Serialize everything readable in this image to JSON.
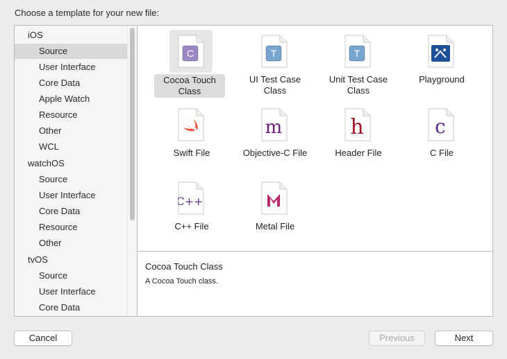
{
  "dialog": {
    "heading": "Choose a template for your new file:"
  },
  "sidebar": {
    "rows": [
      {
        "label": "iOS",
        "kind": "group"
      },
      {
        "label": "Source",
        "kind": "item",
        "selected": true
      },
      {
        "label": "User Interface",
        "kind": "item"
      },
      {
        "label": "Core Data",
        "kind": "item"
      },
      {
        "label": "Apple Watch",
        "kind": "item"
      },
      {
        "label": "Resource",
        "kind": "item"
      },
      {
        "label": "Other",
        "kind": "item"
      },
      {
        "label": "WCL",
        "kind": "item"
      },
      {
        "label": "watchOS",
        "kind": "group"
      },
      {
        "label": "Source",
        "kind": "item"
      },
      {
        "label": "User Interface",
        "kind": "item"
      },
      {
        "label": "Core Data",
        "kind": "item"
      },
      {
        "label": "Resource",
        "kind": "item"
      },
      {
        "label": "Other",
        "kind": "item"
      },
      {
        "label": "tvOS",
        "kind": "group"
      },
      {
        "label": "Source",
        "kind": "item"
      },
      {
        "label": "User Interface",
        "kind": "item"
      },
      {
        "label": "Core Data",
        "kind": "item"
      }
    ]
  },
  "templates": [
    {
      "label": "Cocoa Touch Class",
      "icon": "cocoa-touch-class-icon",
      "glyph": "C",
      "selected": true
    },
    {
      "label": "UI Test Case Class",
      "icon": "ui-test-case-class-icon",
      "glyph": "T"
    },
    {
      "label": "Unit Test Case Class",
      "icon": "unit-test-case-class-icon",
      "glyph": "T"
    },
    {
      "label": "Playground",
      "icon": "playground-icon",
      "glyph": ""
    },
    {
      "label": "Swift File",
      "icon": "swift-file-icon",
      "glyph": ""
    },
    {
      "label": "Objective-C File",
      "icon": "objective-c-file-icon",
      "glyph": "m"
    },
    {
      "label": "Header File",
      "icon": "header-file-icon",
      "glyph": "h"
    },
    {
      "label": "C File",
      "icon": "c-file-icon",
      "glyph": "c"
    },
    {
      "label": "C++ File",
      "icon": "cpp-file-icon",
      "glyph": "C++"
    },
    {
      "label": "Metal File",
      "icon": "metal-file-icon",
      "glyph": ""
    }
  ],
  "description": {
    "title": "Cocoa Touch Class",
    "text": "A Cocoa Touch class."
  },
  "buttons": {
    "cancel": "Cancel",
    "previous": "Previous",
    "next": "Next"
  },
  "colors": {
    "cocoa_badge": "#9b87c6",
    "test_badge": "#78a6cf",
    "playground_badge": "#1e4f99",
    "swift_orange": "#f05138",
    "objc_purple": "#6a1a7a",
    "header_red": "#a0152a",
    "c_purple": "#5a2a8a",
    "metal_magenta": "#b5286a"
  }
}
